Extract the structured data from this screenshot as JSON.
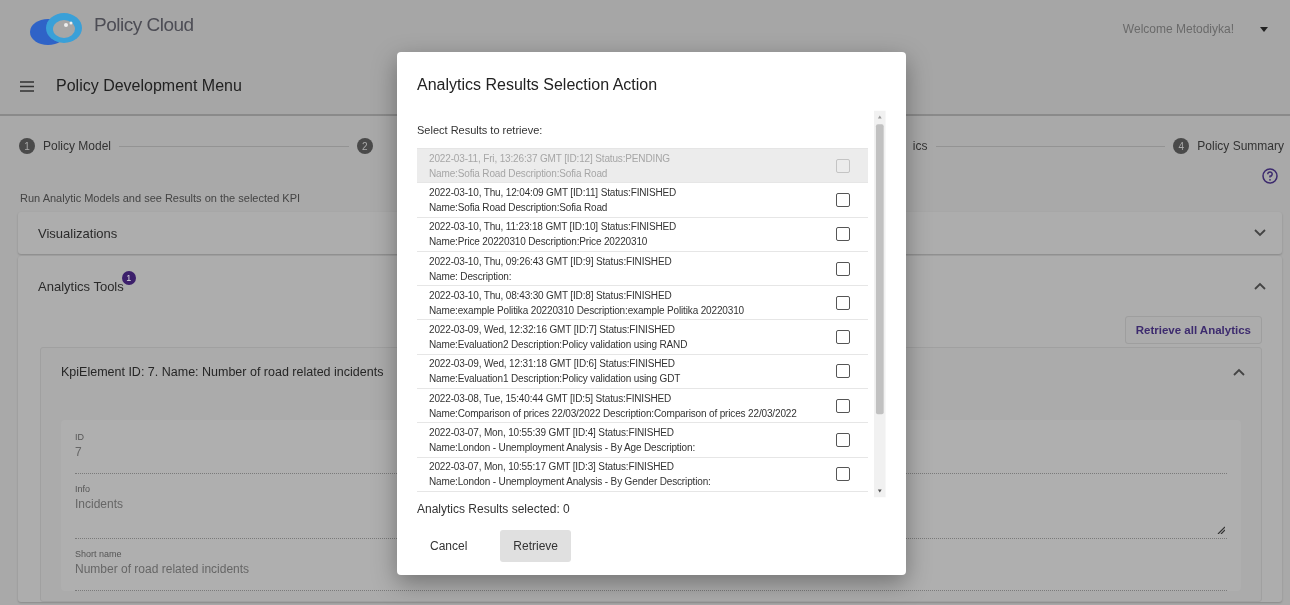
{
  "header": {
    "brand": "Policy Cloud",
    "welcome": "Welcome Metodiyka!"
  },
  "toolbar": {
    "title": "Policy Development Menu"
  },
  "stepper": [
    {
      "number": "1",
      "label": "Policy Model"
    },
    {
      "number": "2"
    },
    {
      "label": "ics"
    },
    {
      "number": "4",
      "label": "Policy Summary"
    }
  ],
  "intro": "Run Analytic Models and see Results on the selected KPI",
  "panels": [
    {
      "title": "Visualizations",
      "expanded": false
    },
    {
      "title": "Analytics Tools",
      "badge": "1",
      "expanded": true,
      "action": "Retrieve all Analytics",
      "kpi": {
        "title": "KpiElement ID: 7. Name: Number of road related incidents",
        "expanded": true,
        "fields": [
          {
            "kind": "text",
            "label": "ID",
            "value": "7"
          },
          {
            "kind": "textarea",
            "label": "Info",
            "value": "Incidents"
          },
          {
            "kind": "text",
            "label": "Short name",
            "value": "Number of road related incidents"
          }
        ]
      }
    }
  ],
  "dialog": {
    "title": "Analytics Results Selection Action",
    "prompt": "Select Results to retrieve:",
    "results": [
      {
        "line1": "2022-03-11, Fri, 13:26:37 GMT [ID:12] Status:PENDING",
        "line2": "Name:Sofia Road Description:Sofia Road",
        "disabled": true,
        "checked": false
      },
      {
        "line1": "2022-03-10, Thu, 12:04:09 GMT [ID:11] Status:FINISHED",
        "line2": "Name:Sofia Road Description:Sofia Road",
        "disabled": false,
        "checked": false
      },
      {
        "line1": "2022-03-10, Thu, 11:23:18 GMT [ID:10] Status:FINISHED",
        "line2": "Name:Price 20220310 Description:Price 20220310",
        "disabled": false,
        "checked": false
      },
      {
        "line1": "2022-03-10, Thu, 09:26:43 GMT [ID:9] Status:FINISHED",
        "line2": "Name: Description:",
        "disabled": false,
        "checked": false
      },
      {
        "line1": "2022-03-10, Thu, 08:43:30 GMT [ID:8] Status:FINISHED",
        "line2": "Name:example Politika 20220310 Description:example Politika 20220310",
        "disabled": false,
        "checked": false
      },
      {
        "line1": "2022-03-09, Wed, 12:32:16 GMT [ID:7] Status:FINISHED",
        "line2": "Name:Evaluation2 Description:Policy validation using RAND",
        "disabled": false,
        "checked": false
      },
      {
        "line1": "2022-03-09, Wed, 12:31:18 GMT [ID:6] Status:FINISHED",
        "line2": "Name:Evaluation1 Description:Policy validation using GDT",
        "disabled": false,
        "checked": false
      },
      {
        "line1": "2022-03-08, Tue, 15:40:44 GMT [ID:5] Status:FINISHED",
        "line2": "Name:Comparison of prices 22/03/2022 Description:Comparison of prices 22/03/2022",
        "disabled": false,
        "checked": false
      },
      {
        "line1": "2022-03-07, Mon, 10:55:39 GMT [ID:4] Status:FINISHED",
        "line2": "Name:London - Unemployment Analysis - By Age Description:",
        "disabled": false,
        "checked": false
      },
      {
        "line1": "2022-03-07, Mon, 10:55:17 GMT [ID:3] Status:FINISHED",
        "line2": "Name:London - Unemployment Analysis - By Gender Description:",
        "disabled": false,
        "checked": false
      }
    ],
    "summary": "Analytics Results selected: 0",
    "buttons": [
      {
        "kind": "text",
        "label": "Cancel"
      },
      {
        "kind": "contained",
        "label": "Retrieve"
      }
    ]
  }
}
